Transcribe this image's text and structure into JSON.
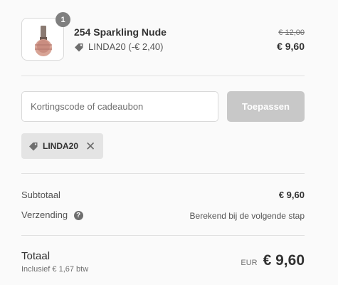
{
  "product": {
    "quantity": "1",
    "name": "254 Sparkling Nude",
    "discount_label": "LINDA20 (-€ 2,40)",
    "original_price": "€ 12,00",
    "price": "€ 9,60"
  },
  "discount": {
    "input_placeholder": "Kortingscode of cadeaubon",
    "apply_label": "Toepassen",
    "applied_code": "LINDA20",
    "remove_icon": "close-icon"
  },
  "summary": {
    "subtotal_label": "Subtotaal",
    "subtotal_value": "€ 9,60",
    "shipping_label": "Verzending",
    "shipping_help_icon": "question-icon",
    "shipping_value": "Berekend bij de volgende stap"
  },
  "total": {
    "label": "Totaal",
    "tax_note": "Inclusief € 1,67 btw",
    "currency": "EUR",
    "amount": "€ 9,60"
  },
  "colors": {
    "background": "#fafafa",
    "apply_button_disabled": "#c8c8c8",
    "chip_background": "#e4e4e4",
    "badge": "#7f7f7f"
  }
}
